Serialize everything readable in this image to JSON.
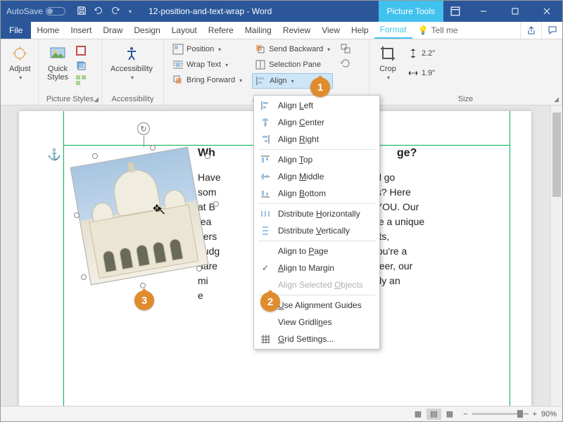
{
  "titlebar": {
    "autosave": "AutoSave",
    "doc": "12-position-and-text-wrap - Word",
    "picture_tools": "Picture Tools"
  },
  "tabs": {
    "file": "File",
    "list": [
      "Home",
      "Insert",
      "Draw",
      "Design",
      "Layout",
      "Refere",
      "Mailing",
      "Review",
      "View",
      "Help"
    ],
    "format": "Format",
    "tellme": "Tell me"
  },
  "ribbon": {
    "adjust": "Adjust",
    "picture_styles": "Picture Styles",
    "quick_styles": "Quick\nStyles",
    "accessibility": "Accessibility",
    "accessibility_group": "Accessibility",
    "position": "Position",
    "wrap_text": "Wrap Text",
    "bring_forward": "Bring Forward",
    "send_backward": "Send Backward",
    "selection_pane": "Selection Pane",
    "align": "Align",
    "arrange": "Arrange",
    "crop": "Crop",
    "height": "2.2\"",
    "width": "1.9\"",
    "size": "Size"
  },
  "menu": {
    "items": [
      {
        "label": "Align Left",
        "u": "L",
        "icon": "al"
      },
      {
        "label": "Align Center",
        "u": "C",
        "icon": "ac"
      },
      {
        "label": "Align Right",
        "u": "R",
        "icon": "ar"
      },
      {
        "label": "Align Top",
        "u": "T",
        "icon": "at"
      },
      {
        "label": "Align Middle",
        "u": "M",
        "icon": "am"
      },
      {
        "label": "Align Bottom",
        "u": "B",
        "icon": "ab"
      },
      {
        "label": "Distribute Horizontally",
        "u": "H",
        "icon": "dh"
      },
      {
        "label": "Distribute Vertically",
        "u": "V",
        "icon": "dv"
      }
    ],
    "align_to_page": "Align to Page",
    "align_to_margin": "Align to Margin",
    "align_selected": "Align Selected Objects",
    "use_guides": "Use Alignment Guides",
    "view_gridlines": "View Gridlines",
    "grid_settings": "Grid Settings..."
  },
  "doc": {
    "heading_prefix": "Wh",
    "heading_suffix": "ge?",
    "lines": [
      [
        "Have",
        "get up and go"
      ],
      [
        "som",
        "r the details?  Here"
      ],
      [
        "at B",
        "ip around YOU. Our"
      ],
      [
        "tea",
        "s will create a unique"
      ],
      [
        "pers",
        "our interests,"
      ],
      [
        "budg",
        "Whether you're a"
      ],
      [
        "dare",
        "ual sight-seer, our"
      ],
      [
        "mi",
        "acation truly an"
      ],
      [
        "e",
        ""
      ]
    ]
  },
  "callouts": {
    "c1": "1",
    "c2": "2",
    "c3": "3"
  },
  "status": {
    "zoom": "90%"
  }
}
